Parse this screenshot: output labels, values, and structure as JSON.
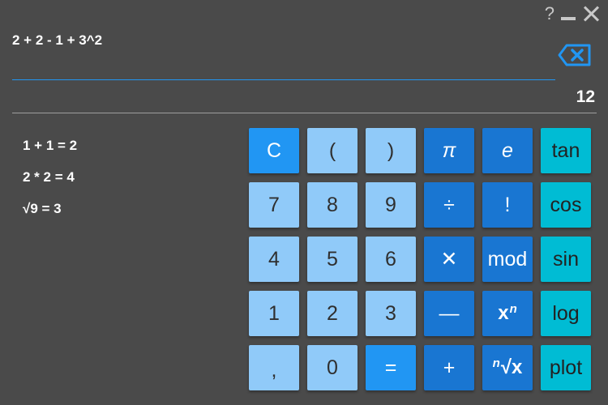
{
  "window": {
    "help_label": "?",
    "minimize_icon": "minimize-icon",
    "close_icon": "close-icon"
  },
  "display": {
    "expression": "2 + 2 - 1 + 3^2",
    "result": "12",
    "backspace_icon": "backspace-icon",
    "accent_color": "#2196f3"
  },
  "history": [
    "1 + 1 = 2",
    "2 * 2 = 4",
    "√9 = 3"
  ],
  "keys": {
    "clear": "C",
    "open_paren": "(",
    "close_paren": ")",
    "pi": "π",
    "e": "e",
    "tan": "tan",
    "seven": "7",
    "eight": "8",
    "nine": "9",
    "divide": "÷",
    "factorial": "!",
    "cos": "cos",
    "four": "4",
    "five": "5",
    "six": "6",
    "multiply": "✕",
    "mod": "mod",
    "sin": "sin",
    "one": "1",
    "two": "2",
    "three": "3",
    "minus": "—",
    "power_base": "x",
    "power_exp": "n",
    "log": "log",
    "comma": ",",
    "zero": "0",
    "equals": "=",
    "plus": "+",
    "root_index": "n",
    "root_body": "√x",
    "plot": "plot"
  },
  "colors": {
    "background": "#4a4a4a",
    "number_key": "#90caf9",
    "action_key": "#2196f3",
    "operator_key": "#1976d2",
    "function_key": "#00bcd4"
  }
}
